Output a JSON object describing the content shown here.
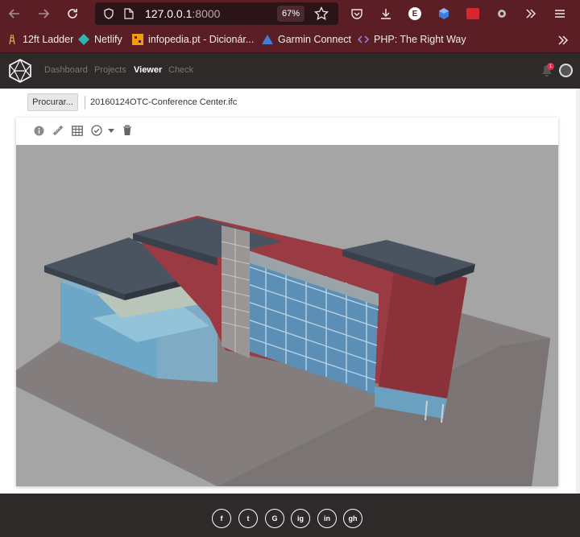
{
  "browser": {
    "url_host": "127.0.0.1",
    "url_port": ":8000",
    "zoom": "67%",
    "extension_letter": "E"
  },
  "bookmarks": [
    {
      "label": "12ft Ladder",
      "icon": "ladder-icon"
    },
    {
      "label": "Netlify",
      "icon": "netlify-icon"
    },
    {
      "label": "infopedia.pt - Dicionár...",
      "icon": "infopedia-icon"
    },
    {
      "label": "Garmin Connect",
      "icon": "garmin-icon"
    },
    {
      "label": "PHP: The Right Way",
      "icon": "php-icon"
    }
  ],
  "app": {
    "nav": [
      {
        "label": "Dashboard",
        "active": false
      },
      {
        "label": "Projects",
        "active": false
      },
      {
        "label": "Viewer",
        "active": true
      },
      {
        "label": "Check",
        "active": false
      }
    ],
    "notification_count": "1"
  },
  "file": {
    "browse_label": "Procurar...",
    "file_name": "20160124OTC-Conference Center.ifc"
  },
  "viewer_tools": [
    "info-icon",
    "measure-icon",
    "table-icon",
    "check-circle-icon",
    "caret-down-icon",
    "trash-icon"
  ],
  "footer_social": [
    {
      "label": "f",
      "icon": "facebook-icon"
    },
    {
      "label": "t",
      "icon": "twitter-icon"
    },
    {
      "label": "G",
      "icon": "google-icon"
    },
    {
      "label": "ig",
      "icon": "instagram-icon"
    },
    {
      "label": "in",
      "icon": "linkedin-icon"
    },
    {
      "label": "gh",
      "icon": "github-icon"
    }
  ],
  "colors": {
    "browser_chrome": "#5b1e24",
    "app_header": "#2e2a2a",
    "viewport_bg": "#a5a5a5",
    "building_wall": "#9a3a42",
    "building_roof": "#4a5360",
    "glass": "#7fb3d1"
  }
}
